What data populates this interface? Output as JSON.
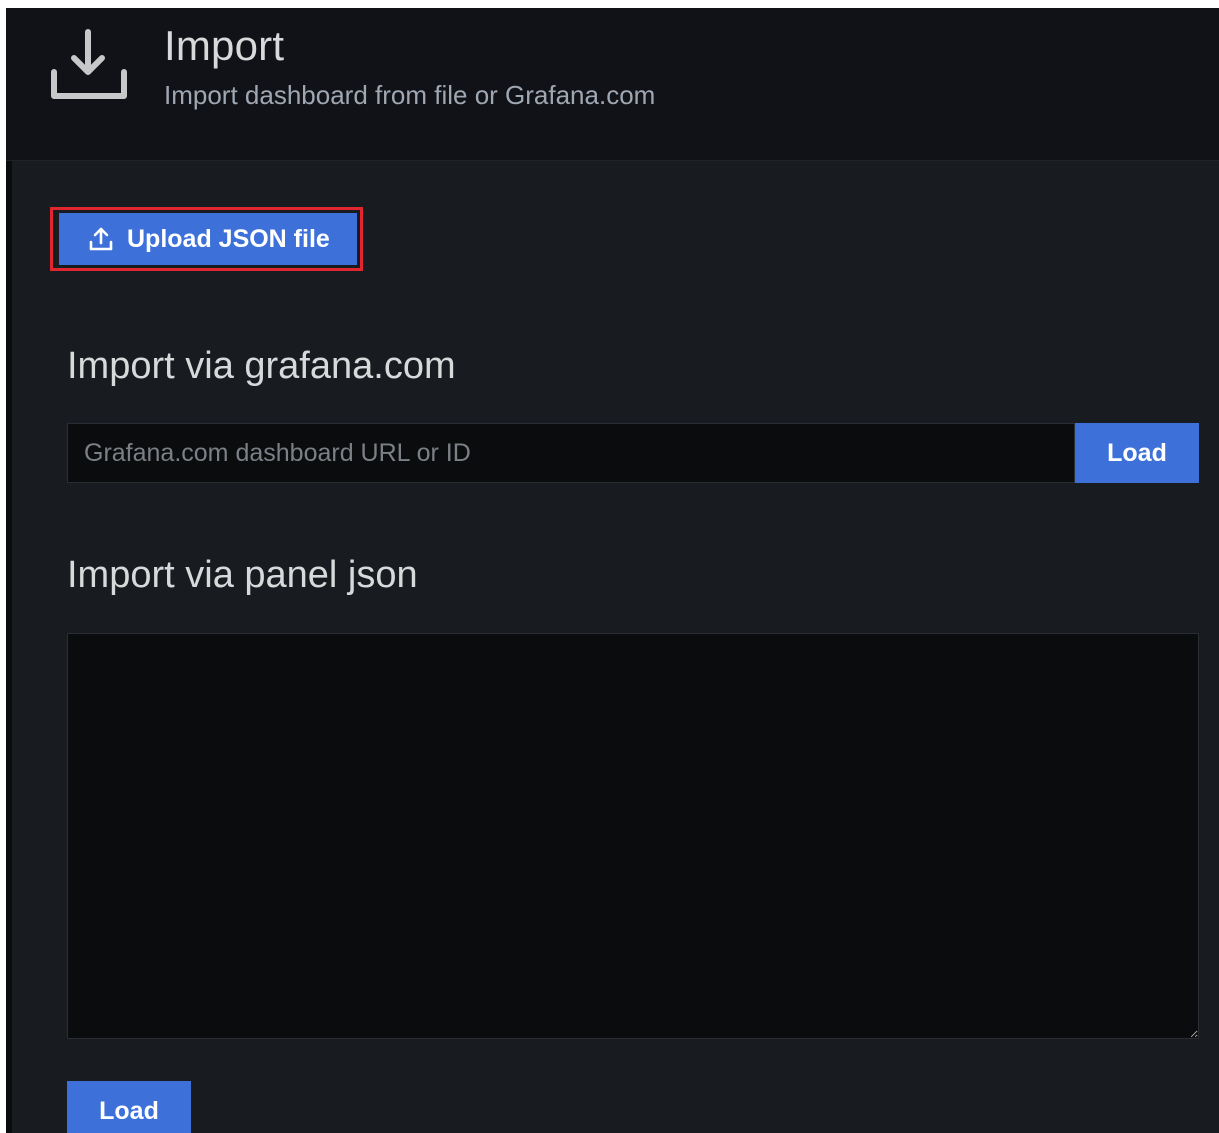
{
  "header": {
    "title": "Import",
    "subtitle": "Import dashboard from file or Grafana.com",
    "icon": "import-download-icon"
  },
  "upload": {
    "label": "Upload JSON file",
    "icon": "upload-icon",
    "highlight_color": "#e0262e"
  },
  "grafana_section": {
    "title": "Import via grafana.com",
    "input_placeholder": "Grafana.com dashboard URL or ID",
    "input_value": "",
    "load_label": "Load"
  },
  "panel_section": {
    "title": "Import via panel json",
    "textarea_value": "",
    "load_label": "Load"
  },
  "colors": {
    "primary_button": "#3d71d9",
    "background": "#181b1f",
    "header_background": "#111217",
    "input_background": "#0b0c0e"
  }
}
